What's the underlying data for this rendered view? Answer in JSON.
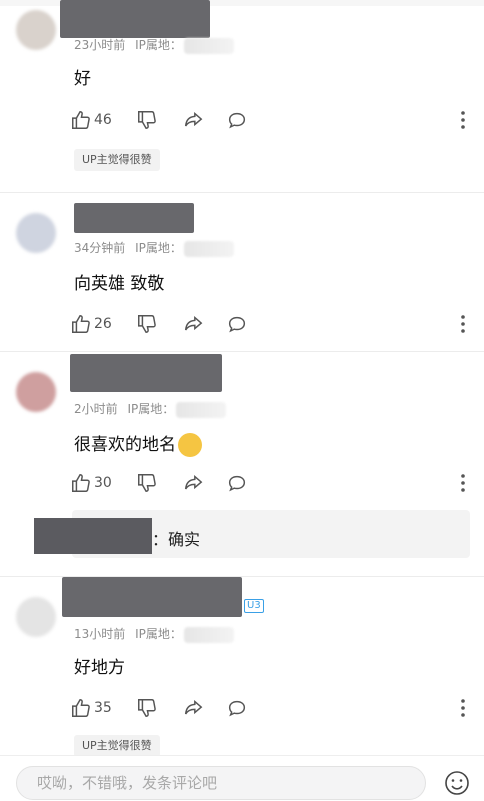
{
  "comments": [
    {
      "time": "23小时前",
      "ip_label": "IP属地：",
      "text": "好",
      "likes": "46",
      "tag": "UP主觉得很赞",
      "avatar_color": "#d9d2cc"
    },
    {
      "time": "34分钟前",
      "ip_label": "IP属地：",
      "text": "向英雄 致敬",
      "likes": "26",
      "avatar_color": "#cfd4e0"
    },
    {
      "time": "2小时前",
      "ip_label": "IP属地：",
      "text": "很喜欢的地名",
      "likes": "30",
      "reply_text": "：确实",
      "avatar_color": "#cf9f9f"
    },
    {
      "time": "13小时前",
      "ip_label": "IP属地：",
      "text": "好地方",
      "likes": "35",
      "tag": "UP主觉得很赞",
      "badge": "U3",
      "avatar_color": "#e4e4e4"
    }
  ],
  "input": {
    "placeholder": "哎呦，不错哦，发条评论吧"
  },
  "colors": {
    "icon": "#555555",
    "meta": "#8c8c8c",
    "redaction": "#5b5b60"
  },
  "icons": [
    "thumb-up-icon",
    "thumb-down-icon",
    "share-icon",
    "comment-icon",
    "more-icon",
    "emoji-icon"
  ]
}
